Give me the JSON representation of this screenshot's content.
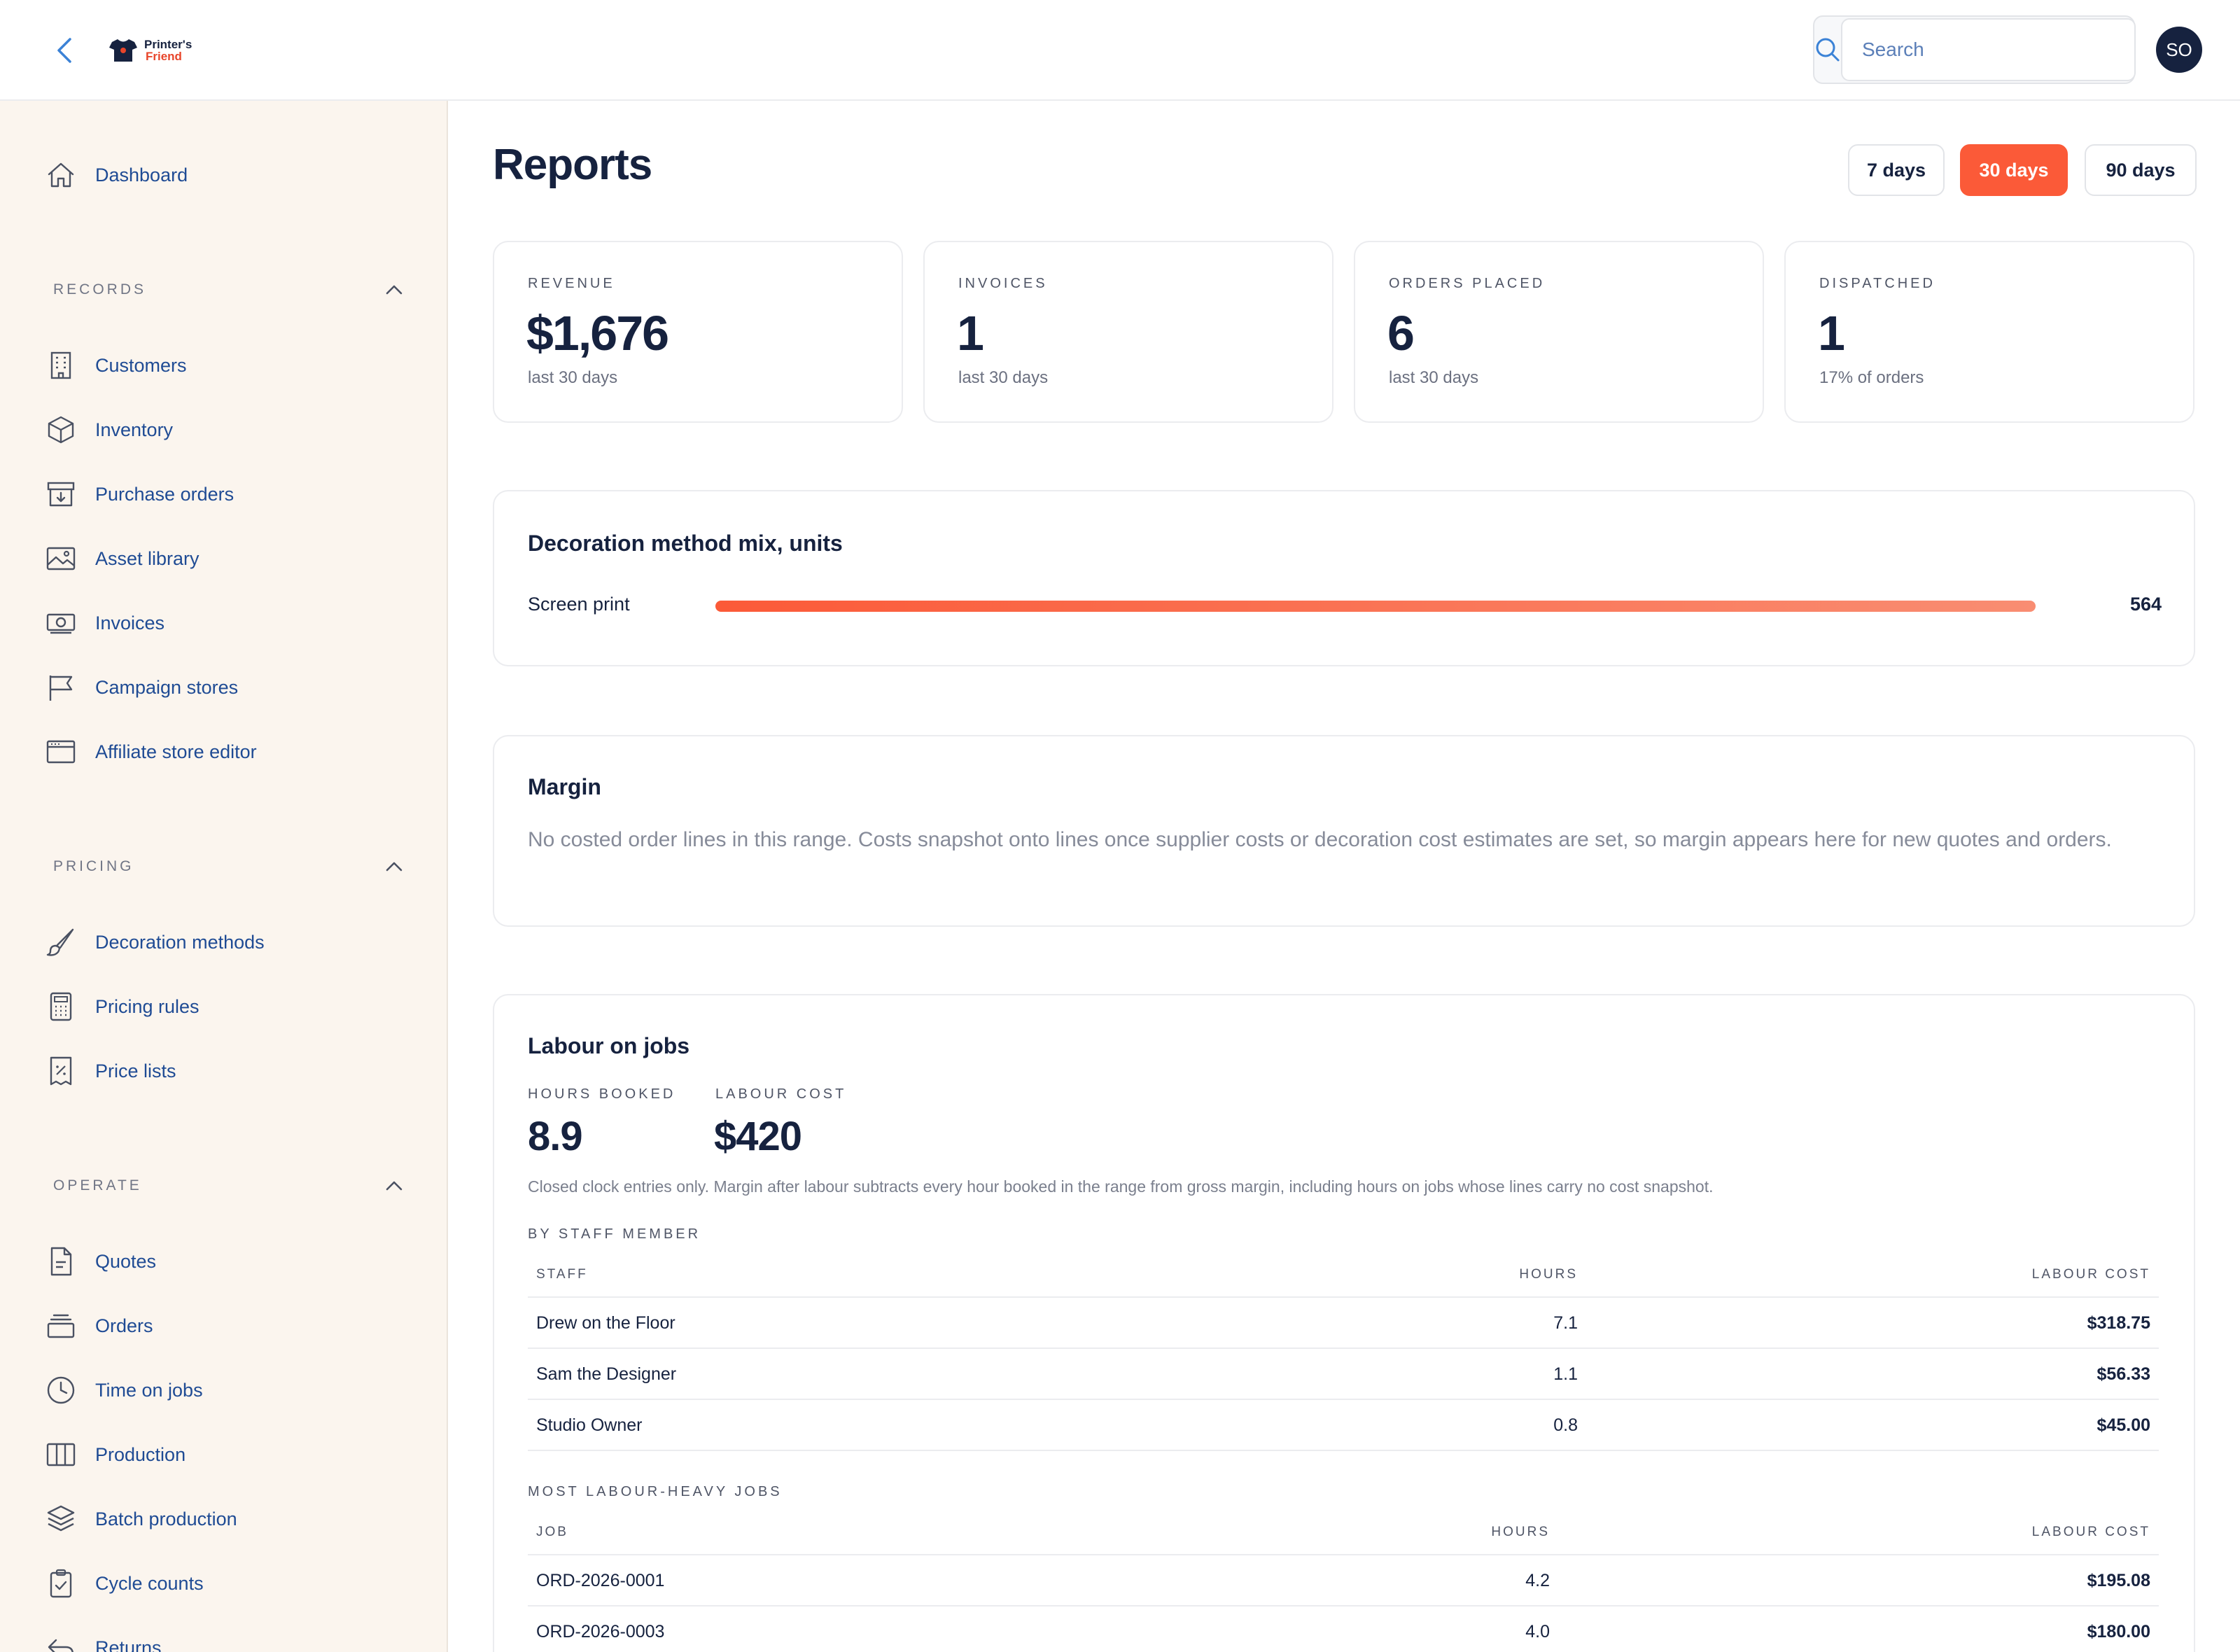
{
  "header": {
    "logo_line1": "Printer's",
    "logo_line2": "Friend",
    "search_placeholder": "Search",
    "avatar_initials": "SO"
  },
  "sidebar": {
    "dashboard": "Dashboard",
    "sections": {
      "records": "RECORDS",
      "pricing": "PRICING",
      "operate": "OPERATE"
    },
    "records": [
      "Customers",
      "Inventory",
      "Purchase orders",
      "Asset library",
      "Invoices",
      "Campaign stores",
      "Affiliate store editor"
    ],
    "pricing": [
      "Decoration methods",
      "Pricing rules",
      "Price lists"
    ],
    "operate": [
      "Quotes",
      "Orders",
      "Time on jobs",
      "Production",
      "Batch production",
      "Cycle counts",
      "Returns"
    ]
  },
  "main": {
    "title": "Reports",
    "ranges": [
      "7 days",
      "30 days",
      "90 days"
    ],
    "active_range": "30 days",
    "stats": [
      {
        "label": "REVENUE",
        "value": "$1,676",
        "sub": "last 30 days"
      },
      {
        "label": "INVOICES",
        "value": "1",
        "sub": "last 30 days"
      },
      {
        "label": "ORDERS PLACED",
        "value": "6",
        "sub": "last 30 days"
      },
      {
        "label": "DISPATCHED",
        "value": "1",
        "sub": "17% of orders"
      }
    ],
    "decoration": {
      "title": "Decoration method mix, units",
      "rows": [
        {
          "label": "Screen print",
          "value": "564",
          "fraction": 1.0
        }
      ]
    },
    "margin": {
      "title": "Margin",
      "text": "No costed order lines in this range. Costs snapshot onto lines once supplier costs or decoration cost estimates are set, so margin appears here for new quotes and orders."
    },
    "labour": {
      "title": "Labour on jobs",
      "hours_label": "HOURS BOOKED",
      "hours_value": "8.9",
      "cost_label": "LABOUR COST",
      "cost_value": "$420",
      "note": "Closed clock entries only. Margin after labour subtracts every hour booked in the range from gross margin, including hours on jobs whose lines carry no cost snapshot.",
      "by_staff": {
        "heading": "BY STAFF MEMBER",
        "columns": [
          "STAFF",
          "HOURS",
          "LABOUR COST"
        ],
        "rows": [
          [
            "Drew on the Floor",
            "7.1",
            "$318.75"
          ],
          [
            "Sam the Designer",
            "1.1",
            "$56.33"
          ],
          [
            "Studio Owner",
            "0.8",
            "$45.00"
          ]
        ]
      },
      "heavy_jobs": {
        "heading": "MOST LABOUR-HEAVY JOBS",
        "columns": [
          "JOB",
          "HOURS",
          "LABOUR COST"
        ],
        "rows": [
          [
            "ORD-2026-0001",
            "4.2",
            "$195.08"
          ],
          [
            "ORD-2026-0003",
            "4.0",
            "$180.00"
          ]
        ]
      }
    }
  }
}
